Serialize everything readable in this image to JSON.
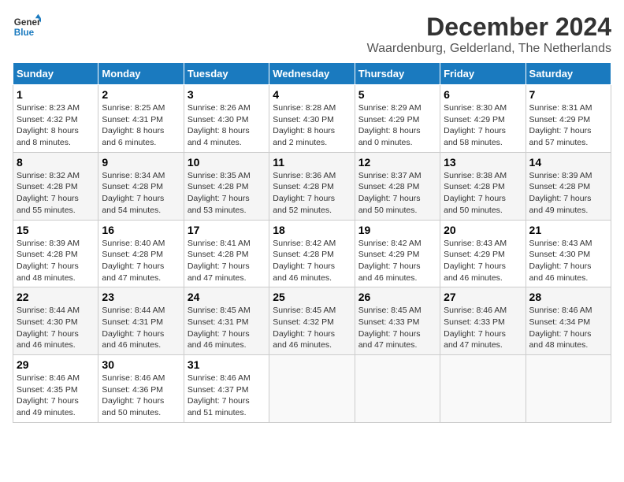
{
  "logo": {
    "line1": "General",
    "line2": "Blue"
  },
  "title": "December 2024",
  "subtitle": "Waardenburg, Gelderland, The Netherlands",
  "days_of_week": [
    "Sunday",
    "Monday",
    "Tuesday",
    "Wednesday",
    "Thursday",
    "Friday",
    "Saturday"
  ],
  "weeks": [
    [
      {
        "day": "1",
        "info": "Sunrise: 8:23 AM\nSunset: 4:32 PM\nDaylight: 8 hours\nand 8 minutes."
      },
      {
        "day": "2",
        "info": "Sunrise: 8:25 AM\nSunset: 4:31 PM\nDaylight: 8 hours\nand 6 minutes."
      },
      {
        "day": "3",
        "info": "Sunrise: 8:26 AM\nSunset: 4:30 PM\nDaylight: 8 hours\nand 4 minutes."
      },
      {
        "day": "4",
        "info": "Sunrise: 8:28 AM\nSunset: 4:30 PM\nDaylight: 8 hours\nand 2 minutes."
      },
      {
        "day": "5",
        "info": "Sunrise: 8:29 AM\nSunset: 4:29 PM\nDaylight: 8 hours\nand 0 minutes."
      },
      {
        "day": "6",
        "info": "Sunrise: 8:30 AM\nSunset: 4:29 PM\nDaylight: 7 hours\nand 58 minutes."
      },
      {
        "day": "7",
        "info": "Sunrise: 8:31 AM\nSunset: 4:29 PM\nDaylight: 7 hours\nand 57 minutes."
      }
    ],
    [
      {
        "day": "8",
        "info": "Sunrise: 8:32 AM\nSunset: 4:28 PM\nDaylight: 7 hours\nand 55 minutes."
      },
      {
        "day": "9",
        "info": "Sunrise: 8:34 AM\nSunset: 4:28 PM\nDaylight: 7 hours\nand 54 minutes."
      },
      {
        "day": "10",
        "info": "Sunrise: 8:35 AM\nSunset: 4:28 PM\nDaylight: 7 hours\nand 53 minutes."
      },
      {
        "day": "11",
        "info": "Sunrise: 8:36 AM\nSunset: 4:28 PM\nDaylight: 7 hours\nand 52 minutes."
      },
      {
        "day": "12",
        "info": "Sunrise: 8:37 AM\nSunset: 4:28 PM\nDaylight: 7 hours\nand 50 minutes."
      },
      {
        "day": "13",
        "info": "Sunrise: 8:38 AM\nSunset: 4:28 PM\nDaylight: 7 hours\nand 50 minutes."
      },
      {
        "day": "14",
        "info": "Sunrise: 8:39 AM\nSunset: 4:28 PM\nDaylight: 7 hours\nand 49 minutes."
      }
    ],
    [
      {
        "day": "15",
        "info": "Sunrise: 8:39 AM\nSunset: 4:28 PM\nDaylight: 7 hours\nand 48 minutes."
      },
      {
        "day": "16",
        "info": "Sunrise: 8:40 AM\nSunset: 4:28 PM\nDaylight: 7 hours\nand 47 minutes."
      },
      {
        "day": "17",
        "info": "Sunrise: 8:41 AM\nSunset: 4:28 PM\nDaylight: 7 hours\nand 47 minutes."
      },
      {
        "day": "18",
        "info": "Sunrise: 8:42 AM\nSunset: 4:28 PM\nDaylight: 7 hours\nand 46 minutes."
      },
      {
        "day": "19",
        "info": "Sunrise: 8:42 AM\nSunset: 4:29 PM\nDaylight: 7 hours\nand 46 minutes."
      },
      {
        "day": "20",
        "info": "Sunrise: 8:43 AM\nSunset: 4:29 PM\nDaylight: 7 hours\nand 46 minutes."
      },
      {
        "day": "21",
        "info": "Sunrise: 8:43 AM\nSunset: 4:30 PM\nDaylight: 7 hours\nand 46 minutes."
      }
    ],
    [
      {
        "day": "22",
        "info": "Sunrise: 8:44 AM\nSunset: 4:30 PM\nDaylight: 7 hours\nand 46 minutes."
      },
      {
        "day": "23",
        "info": "Sunrise: 8:44 AM\nSunset: 4:31 PM\nDaylight: 7 hours\nand 46 minutes."
      },
      {
        "day": "24",
        "info": "Sunrise: 8:45 AM\nSunset: 4:31 PM\nDaylight: 7 hours\nand 46 minutes."
      },
      {
        "day": "25",
        "info": "Sunrise: 8:45 AM\nSunset: 4:32 PM\nDaylight: 7 hours\nand 46 minutes."
      },
      {
        "day": "26",
        "info": "Sunrise: 8:45 AM\nSunset: 4:33 PM\nDaylight: 7 hours\nand 47 minutes."
      },
      {
        "day": "27",
        "info": "Sunrise: 8:46 AM\nSunset: 4:33 PM\nDaylight: 7 hours\nand 47 minutes."
      },
      {
        "day": "28",
        "info": "Sunrise: 8:46 AM\nSunset: 4:34 PM\nDaylight: 7 hours\nand 48 minutes."
      }
    ],
    [
      {
        "day": "29",
        "info": "Sunrise: 8:46 AM\nSunset: 4:35 PM\nDaylight: 7 hours\nand 49 minutes."
      },
      {
        "day": "30",
        "info": "Sunrise: 8:46 AM\nSunset: 4:36 PM\nDaylight: 7 hours\nand 50 minutes."
      },
      {
        "day": "31",
        "info": "Sunrise: 8:46 AM\nSunset: 4:37 PM\nDaylight: 7 hours\nand 51 minutes."
      },
      {
        "day": "",
        "info": ""
      },
      {
        "day": "",
        "info": ""
      },
      {
        "day": "",
        "info": ""
      },
      {
        "day": "",
        "info": ""
      }
    ]
  ]
}
